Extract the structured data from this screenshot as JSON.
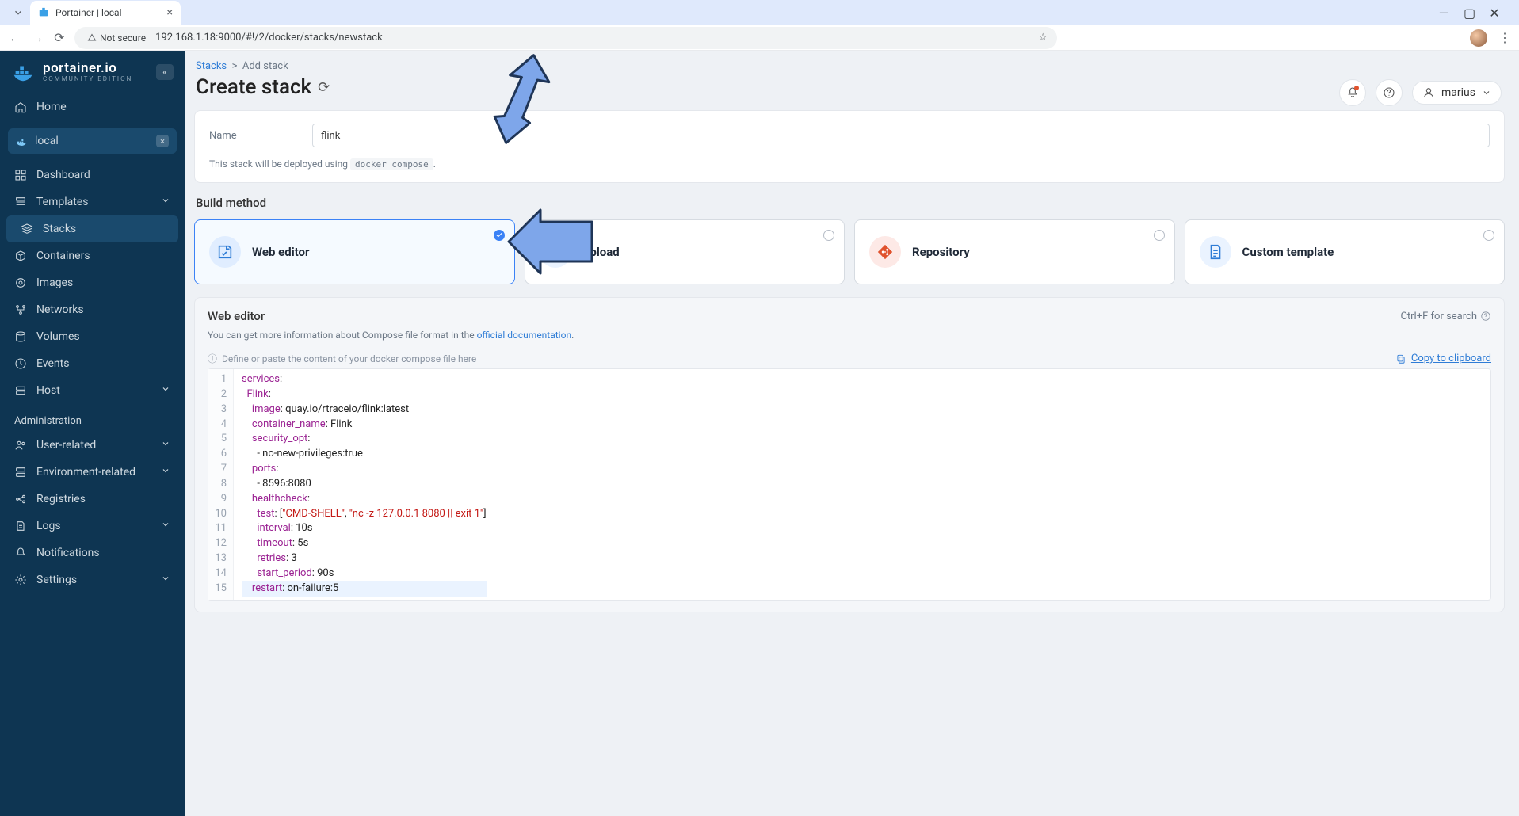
{
  "browser": {
    "tab_title": "Portainer | local",
    "url": "192.168.1.18:9000/#!/2/docker/stacks/newstack",
    "secure_label": "Not secure"
  },
  "logo": {
    "name": "portainer.io",
    "edition": "COMMUNITY EDITION"
  },
  "sidebar": {
    "home": "Home",
    "env_name": "local",
    "items": [
      "Dashboard",
      "Templates",
      "Stacks",
      "Containers",
      "Images",
      "Networks",
      "Volumes",
      "Events",
      "Host"
    ],
    "admin_label": "Administration",
    "admin_items": [
      "User-related",
      "Environment-related",
      "Registries",
      "Logs",
      "Notifications",
      "Settings"
    ]
  },
  "breadcrumb": {
    "root": "Stacks",
    "sep": ">",
    "leaf": "Add stack"
  },
  "page": {
    "title": "Create stack"
  },
  "header": {
    "username": "marius"
  },
  "form": {
    "name_label": "Name",
    "name_value": "flink",
    "deploy_note_pre": "This stack will be deployed using",
    "deploy_note_code": "docker compose",
    "deploy_note_post": "."
  },
  "build": {
    "heading": "Build method",
    "methods": [
      "Web editor",
      "Upload",
      "Repository",
      "Custom template"
    ]
  },
  "editor": {
    "title": "Web editor",
    "search_hint": "Ctrl+F for search",
    "sub_pre": "You can get more information about Compose file format in the ",
    "sub_link": "official documentation",
    "placeholder_hint": "Define or paste the content of your docker compose file here",
    "copy_label": "Copy to clipboard",
    "code_lines": [
      "services:",
      "  Flink:",
      "    image: quay.io/rtraceio/flink:latest",
      "    container_name: Flink",
      "    security_opt:",
      "      - no-new-privileges:true",
      "    ports:",
      "      - 8596:8080",
      "    healthcheck:",
      "      test: [\"CMD-SHELL\", \"nc -z 127.0.0.1 8080 || exit 1\"]",
      "      interval: 10s",
      "      timeout: 5s",
      "      retries: 3",
      "      start_period: 90s",
      "    restart: on-failure:5"
    ]
  }
}
